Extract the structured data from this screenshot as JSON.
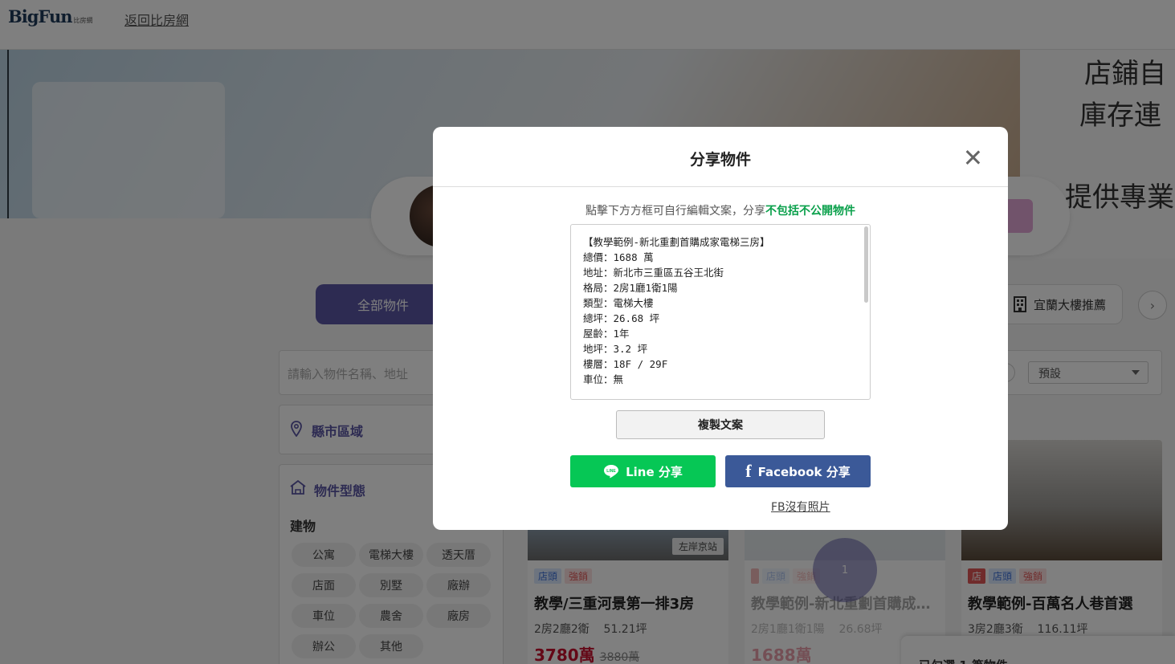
{
  "header": {
    "logo_text": "BigFun",
    "logo_sub": "比房網",
    "back_link": "返回比房網"
  },
  "hero": {
    "line1": "店鋪自",
    "line2": "庫存連",
    "line3": "提供專業"
  },
  "tabs": {
    "all_label": "全部物件",
    "yilan_label": "宜蘭大樓推薦"
  },
  "filters": {
    "search_placeholder": "請輸入物件名稱、地址",
    "region_label": "縣市區域",
    "type_label": "物件型態",
    "building_label": "建物",
    "chips": [
      "公寓",
      "電梯大樓",
      "透天厝",
      "店面",
      "別墅",
      "廠辦",
      "車位",
      "農舍",
      "廠房",
      "辦公",
      "其他"
    ],
    "sort_value": "預設"
  },
  "cards": [
    {
      "badge": "左岸京站",
      "tags": [
        "店頭",
        "強銷"
      ],
      "title": "教學/三重河景第一排3房",
      "meta_layout": "2房2廳2衛",
      "meta_area": "51.21坪",
      "price": "3780萬",
      "old_price": "3880萬"
    },
    {
      "tags": [
        "",
        "店頭",
        "強銷"
      ],
      "title": "教學範例-新北重劃首購成家電梯三房",
      "meta_layout": "2房1廳1衛1陽",
      "meta_area": "26.68坪",
      "price": "1688萬",
      "overlay_count": "1"
    },
    {
      "tags": [
        "店",
        "店頭",
        "強銷"
      ],
      "title": "教學範例-百萬名人巷首選",
      "meta_layout": "3房2廳3衛",
      "meta_area": "116.11坪"
    }
  ],
  "bottom_bar": {
    "text": "已勾選 1 筆物件"
  },
  "modal": {
    "title": "分享物件",
    "hint_prefix": "點擊下方方框可自行編輯文案，分享",
    "hint_highlight": "不包括不公開物件",
    "share_text": "【教學範例-新北重劃首購成家電梯三房】\n總價：1688 萬\n地址：新北市三重區五谷王北街\n格局：2房1廳1衛1陽\n類型：電梯大樓\n總坪：26.68 坪\n屋齡：1年\n地坪：3.2 坪\n樓層：18F / 29F\n車位：無",
    "copy_label": "複製文案",
    "line_label": "Line 分享",
    "fb_label": "Facebook 分享",
    "fb_nophoto_label": "FB沒有照片",
    "colors": {
      "line_green": "#06c755",
      "facebook_blue": "#3b5998",
      "hint_green": "#0aa04b"
    }
  }
}
